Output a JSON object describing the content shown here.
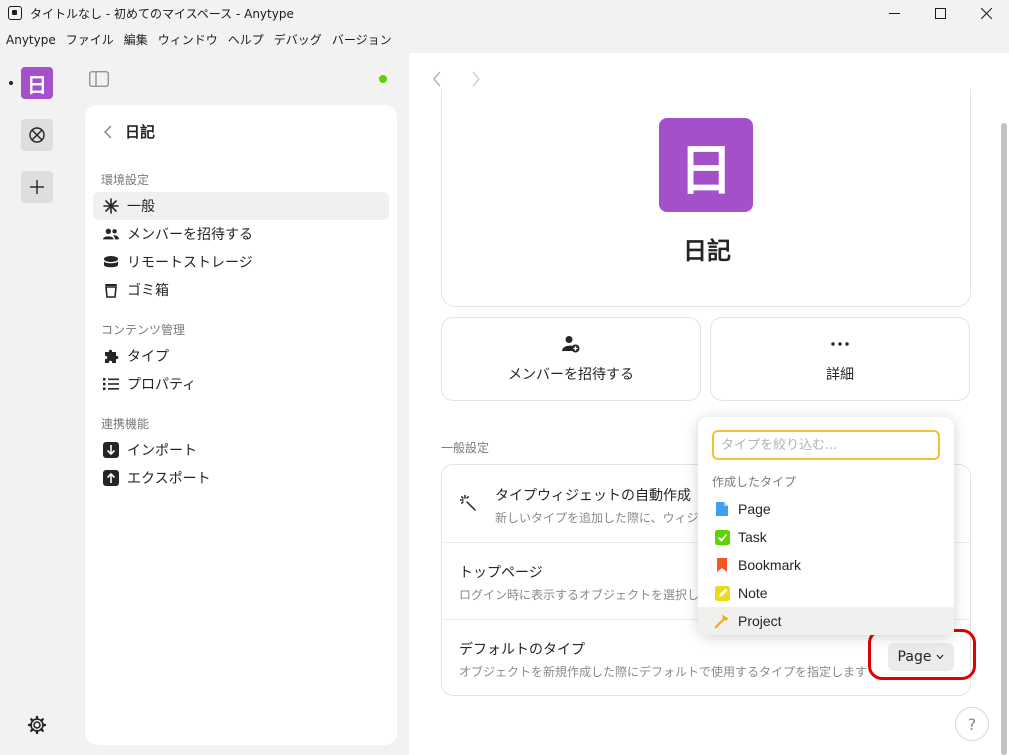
{
  "window": {
    "title": "タイトルなし - 初めてのマイスペース - Anytype",
    "minimize": "—",
    "maximize": "☐",
    "close": "✕"
  },
  "menubar": [
    "Anytype",
    "ファイル",
    "編集",
    "ウィンドウ",
    "ヘルプ",
    "デバッグ",
    "バージョン"
  ],
  "vault": {
    "space_icon_letter": "日",
    "space_color": "#a451c9",
    "sync_status_color": "#5dd400"
  },
  "settings": {
    "title": "日記",
    "sections": [
      {
        "label": "環境設定",
        "items": [
          {
            "label": "一般",
            "icon": "sparkle-icon",
            "active": true
          },
          {
            "label": "メンバーを招待する",
            "icon": "members-icon"
          },
          {
            "label": "リモートストレージ",
            "icon": "storage-icon"
          },
          {
            "label": "ゴミ箱",
            "icon": "trash-icon"
          }
        ]
      },
      {
        "label": "コンテンツ管理",
        "items": [
          {
            "label": "タイプ",
            "icon": "puzzle-icon"
          },
          {
            "label": "プロパティ",
            "icon": "list-icon"
          }
        ]
      },
      {
        "label": "連携機能",
        "items": [
          {
            "label": "インポート",
            "icon": "import-icon"
          },
          {
            "label": "エクスポート",
            "icon": "export-icon"
          }
        ]
      }
    ]
  },
  "main": {
    "space_name": "日記",
    "space_icon_letter": "日",
    "actions": [
      {
        "label": "メンバーを招待する",
        "icon": "add-member-icon"
      },
      {
        "label": "詳細",
        "icon": "more-icon"
      }
    ],
    "section_label": "一般設定",
    "rows": [
      {
        "title": "タイプウィジェットの自動作成",
        "desc": "新しいタイプを追加した際に、ウィジ"
      },
      {
        "title": "トップページ",
        "desc": "ログイン時に表示するオブジェクトを選択し"
      },
      {
        "title": "デフォルトのタイプ",
        "desc": "オブジェクトを新規作成した際にデフォルトで使用するタイプを指定します"
      }
    ],
    "default_type_value": "Page",
    "help": "?"
  },
  "dropdown": {
    "placeholder": "タイプを絞り込む...",
    "section": "作成したタイプ",
    "items": [
      {
        "label": "Page",
        "icon": "page-icon",
        "color": "#3e9ff0"
      },
      {
        "label": "Task",
        "icon": "task-checkbox-icon",
        "color": "#5dd400"
      },
      {
        "label": "Bookmark",
        "icon": "bookmark-icon",
        "color": "#f55522"
      },
      {
        "label": "Note",
        "icon": "note-icon",
        "color": "#ecd91b"
      },
      {
        "label": "Project",
        "icon": "hammer-icon",
        "color": "#f4a800"
      }
    ]
  }
}
